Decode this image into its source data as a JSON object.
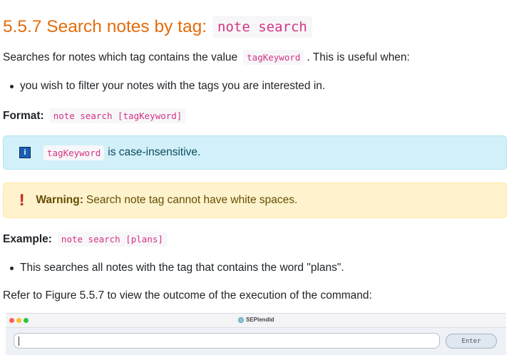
{
  "heading": {
    "number_title": "5.5.7 Search notes by tag:",
    "command": "note search"
  },
  "intro": {
    "prefix": "Searches for notes which tag contains the value",
    "keyword": "tagKeyword",
    "suffix": ". This is useful when:"
  },
  "use_cases": [
    "you wish to filter your notes with the tags you are interested in."
  ],
  "format": {
    "label": "Format:",
    "command": "note search [tagKeyword]"
  },
  "info": {
    "icon": "info-icon",
    "keyword": "tagKeyword",
    "text": "is case-insensitive."
  },
  "warning": {
    "icon": "exclamation-icon",
    "label": "Warning:",
    "text": "Search note tag cannot have white spaces."
  },
  "example": {
    "label": "Example:",
    "command": "note search [plans]"
  },
  "example_notes": [
    "This searches all notes with the tag that contains the word \"plans\"."
  ],
  "refer": "Refer to Figure 5.5.7 to view the outcome of the execution of the command:",
  "screenshot": {
    "app_title": "SEPlendid",
    "command_input_value": "",
    "enter_label": "Enter"
  },
  "colors": {
    "heading": "#e46c0a",
    "code": "#d63384",
    "info_bg": "#d1f0fa",
    "warning_bg": "#fff3cd"
  }
}
